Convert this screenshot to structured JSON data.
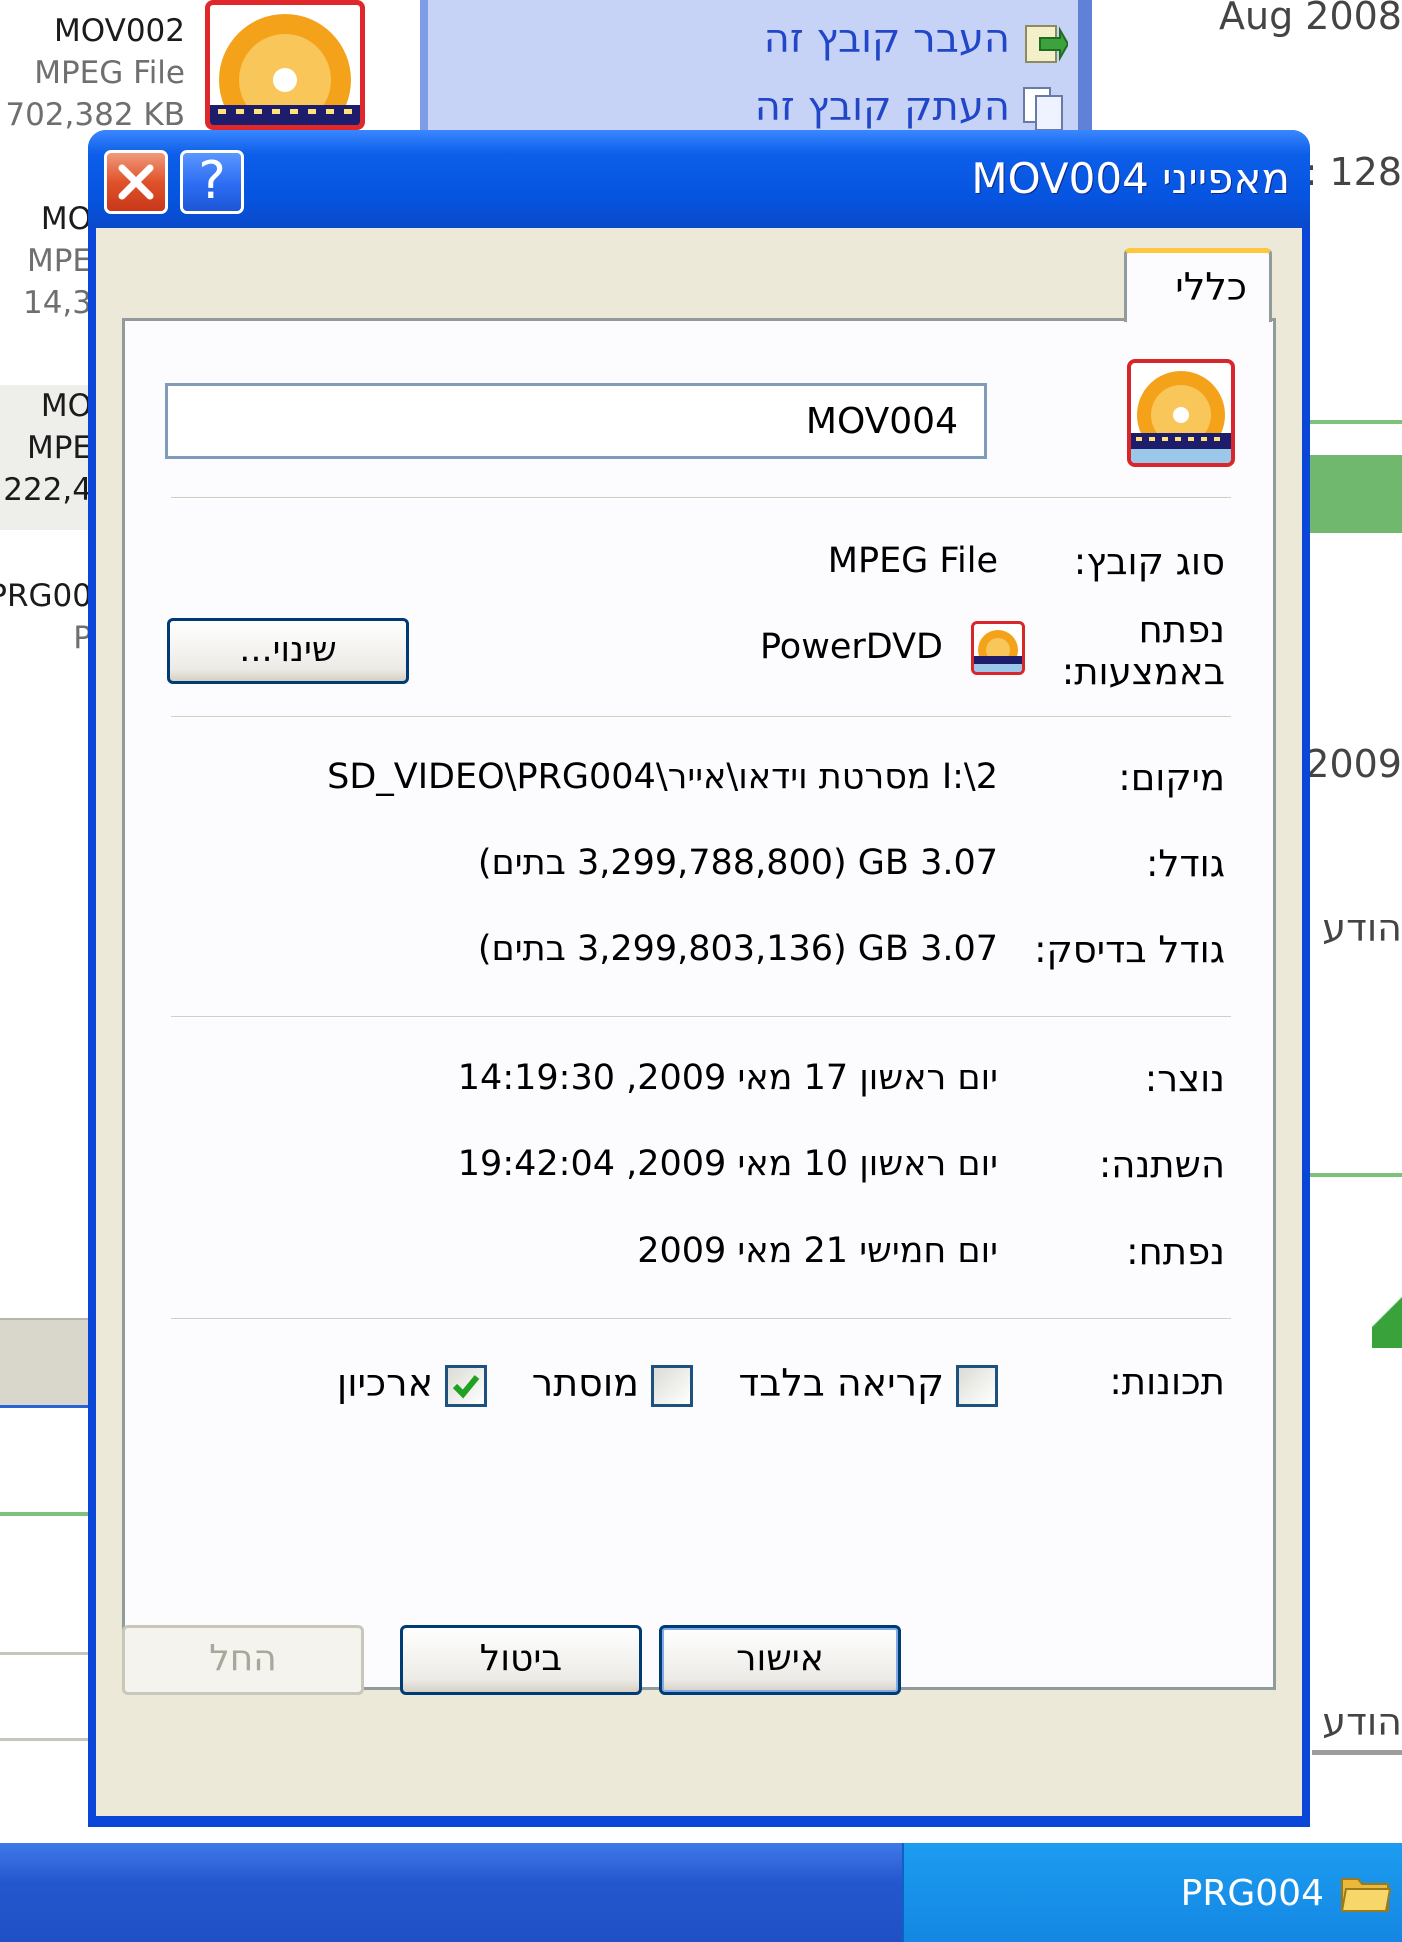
{
  "background": {
    "thumbnails": [
      {
        "name": "MOV002",
        "type": "MPEG File",
        "size": "702,382 KB"
      },
      {
        "name": "MO",
        "type": "MPE",
        "size": "14,3"
      },
      {
        "name": "MO",
        "type": "MPE",
        "size": "222,4"
      },
      {
        "name": "PRG00",
        "type": "P",
        "size": ""
      }
    ],
    "task_pane": {
      "items": [
        {
          "label": "העבר קובץ זה",
          "icon": "move-file-icon"
        },
        {
          "label": "העתק קובץ זה",
          "icon": "copy-file-icon"
        }
      ]
    },
    "right_column": {
      "texts": [
        "Aug 2008",
        "128 :",
        "2009",
        "הודע",
        "הודע"
      ]
    },
    "taskbar": {
      "window_label": "PRG004",
      "icon": "folder-icon"
    }
  },
  "dialog": {
    "title": "מאפייני MOV004",
    "help_label": "?",
    "tab_label": "כללי",
    "file_name": "MOV004",
    "rows": {
      "type": {
        "label": "סוג קובץ:",
        "value": "MPEG File"
      },
      "opens_with": {
        "label": "נפתח באמצעות:",
        "value": "PowerDVD",
        "button": "שינוי..."
      },
      "location": {
        "label": "מיקום:",
        "value": "I:\\2 מסרטת וידאו\\אייר\\SD_VIDEO\\PRG004"
      },
      "size": {
        "label": "גודל:",
        "value": "3.07 GB (3,299,788,800 בתים)"
      },
      "size_on_disk": {
        "label": "גודל בדיסק:",
        "value": "3.07 GB (3,299,803,136 בתים)"
      },
      "created": {
        "label": "נוצר:",
        "value": "יום ראשון 17 מאי 2009, 14:19:30"
      },
      "modified": {
        "label": "השתנה:",
        "value": "יום ראשון 10 מאי 2009, 19:42:04"
      },
      "accessed": {
        "label": "נפתח:",
        "value": "יום חמישי 21 מאי 2009"
      }
    },
    "attributes": {
      "label": "תכונות:",
      "read_only": {
        "label": "קריאה בלבד",
        "checked": false
      },
      "hidden": {
        "label": "מוסתר",
        "checked": false
      },
      "archive": {
        "label": "ארכיון",
        "checked": true
      }
    },
    "buttons": {
      "ok": "אישור",
      "cancel": "ביטול",
      "apply": "החל"
    },
    "colors": {
      "titlebar": "#0654e0",
      "close": "#e0522b",
      "tab_highlight": "#ffc73c"
    }
  }
}
